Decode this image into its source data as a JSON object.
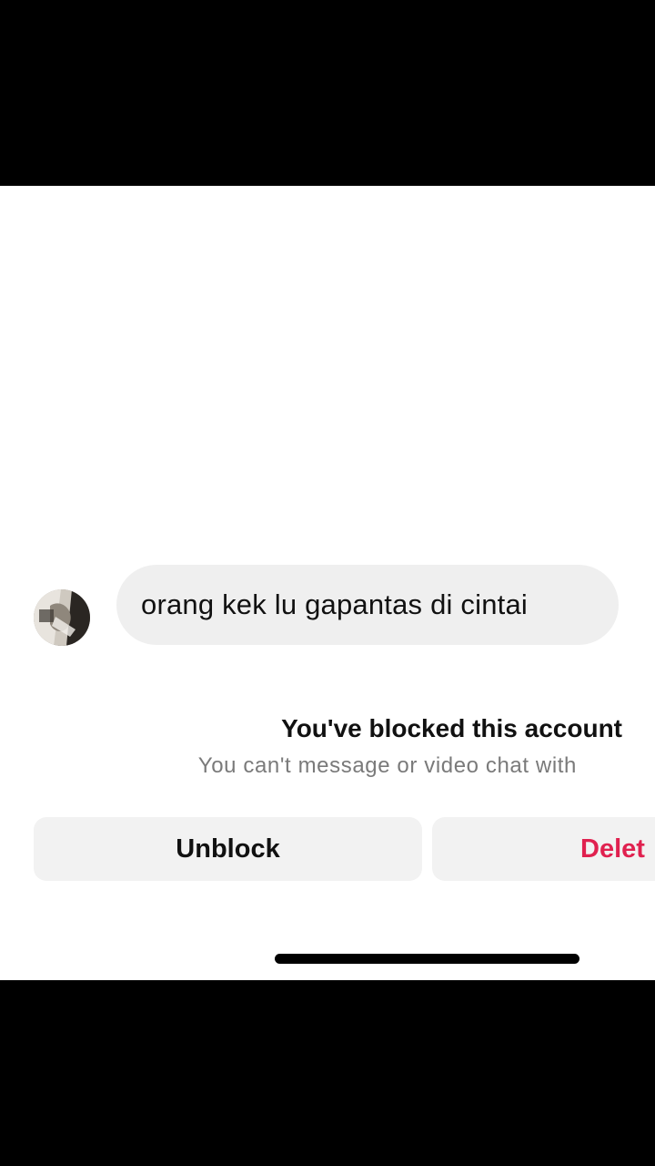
{
  "conversation": {
    "message_text": "orang kek lu gapantas di cintai"
  },
  "blocked_notice": {
    "title": "You've blocked this account",
    "subtitle": "You can't message or video chat with"
  },
  "actions": {
    "unblock_label": "Unblock",
    "delete_label": "Delet",
    "delete_color": "#e0214f"
  },
  "avatar": {
    "icon": "profile-photo"
  }
}
